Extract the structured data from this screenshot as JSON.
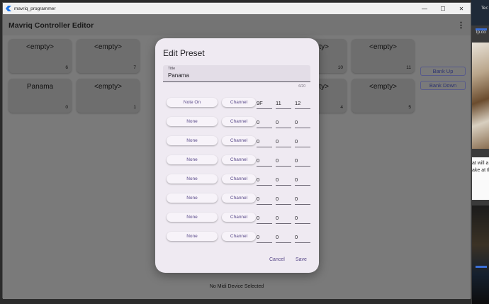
{
  "window": {
    "title": "mavriq_programmer"
  },
  "app": {
    "title": "Mavriq Controller Editor",
    "more_label": "⋮"
  },
  "grid": {
    "top_row": [
      {
        "label": "<empty>",
        "num": "6"
      },
      {
        "label": "<empty>",
        "num": "7"
      },
      {
        "label": "<empty>",
        "num": "10"
      },
      {
        "label": "<empty>",
        "num": "11"
      }
    ],
    "bottom_row": [
      {
        "label": "Panama",
        "num": "0"
      },
      {
        "label": "<empty>",
        "num": "1"
      },
      {
        "label": "<empty>",
        "num": "4"
      },
      {
        "label": "<empty>",
        "num": "5"
      }
    ]
  },
  "bank": {
    "up_label": "Bank Up",
    "down_label": "Bank Down"
  },
  "status": "No Midi Device Selected",
  "dialog": {
    "title": "Edit Preset",
    "field_label": "Title",
    "field_value": "Panama",
    "counter": "6/20",
    "channel_label": "Channel",
    "rows": [
      {
        "type": "Note On",
        "v1": "9F",
        "v2": "11",
        "v3": "12"
      },
      {
        "type": "None",
        "v1": "0",
        "v2": "0",
        "v3": "0"
      },
      {
        "type": "None",
        "v1": "0",
        "v2": "0",
        "v3": "0"
      },
      {
        "type": "None",
        "v1": "0",
        "v2": "0",
        "v3": "0"
      },
      {
        "type": "None",
        "v1": "0",
        "v2": "0",
        "v3": "0"
      },
      {
        "type": "None",
        "v1": "0",
        "v2": "0",
        "v3": "0"
      },
      {
        "type": "None",
        "v1": "0",
        "v2": "0",
        "v3": "0"
      },
      {
        "type": "None",
        "v1": "0",
        "v2": "0",
        "v3": "0"
      }
    ],
    "cancel_label": "Cancel",
    "save_label": "Save"
  },
  "desktop": {
    "tab_label": "Tec",
    "link_label": "lp.co",
    "text_lines": [
      "at will a",
      "ake at th"
    ]
  },
  "colors": {
    "accent": "#5a4a8a",
    "dialog_bg": "#efeaf2",
    "scrim": "#7a7a7a"
  }
}
